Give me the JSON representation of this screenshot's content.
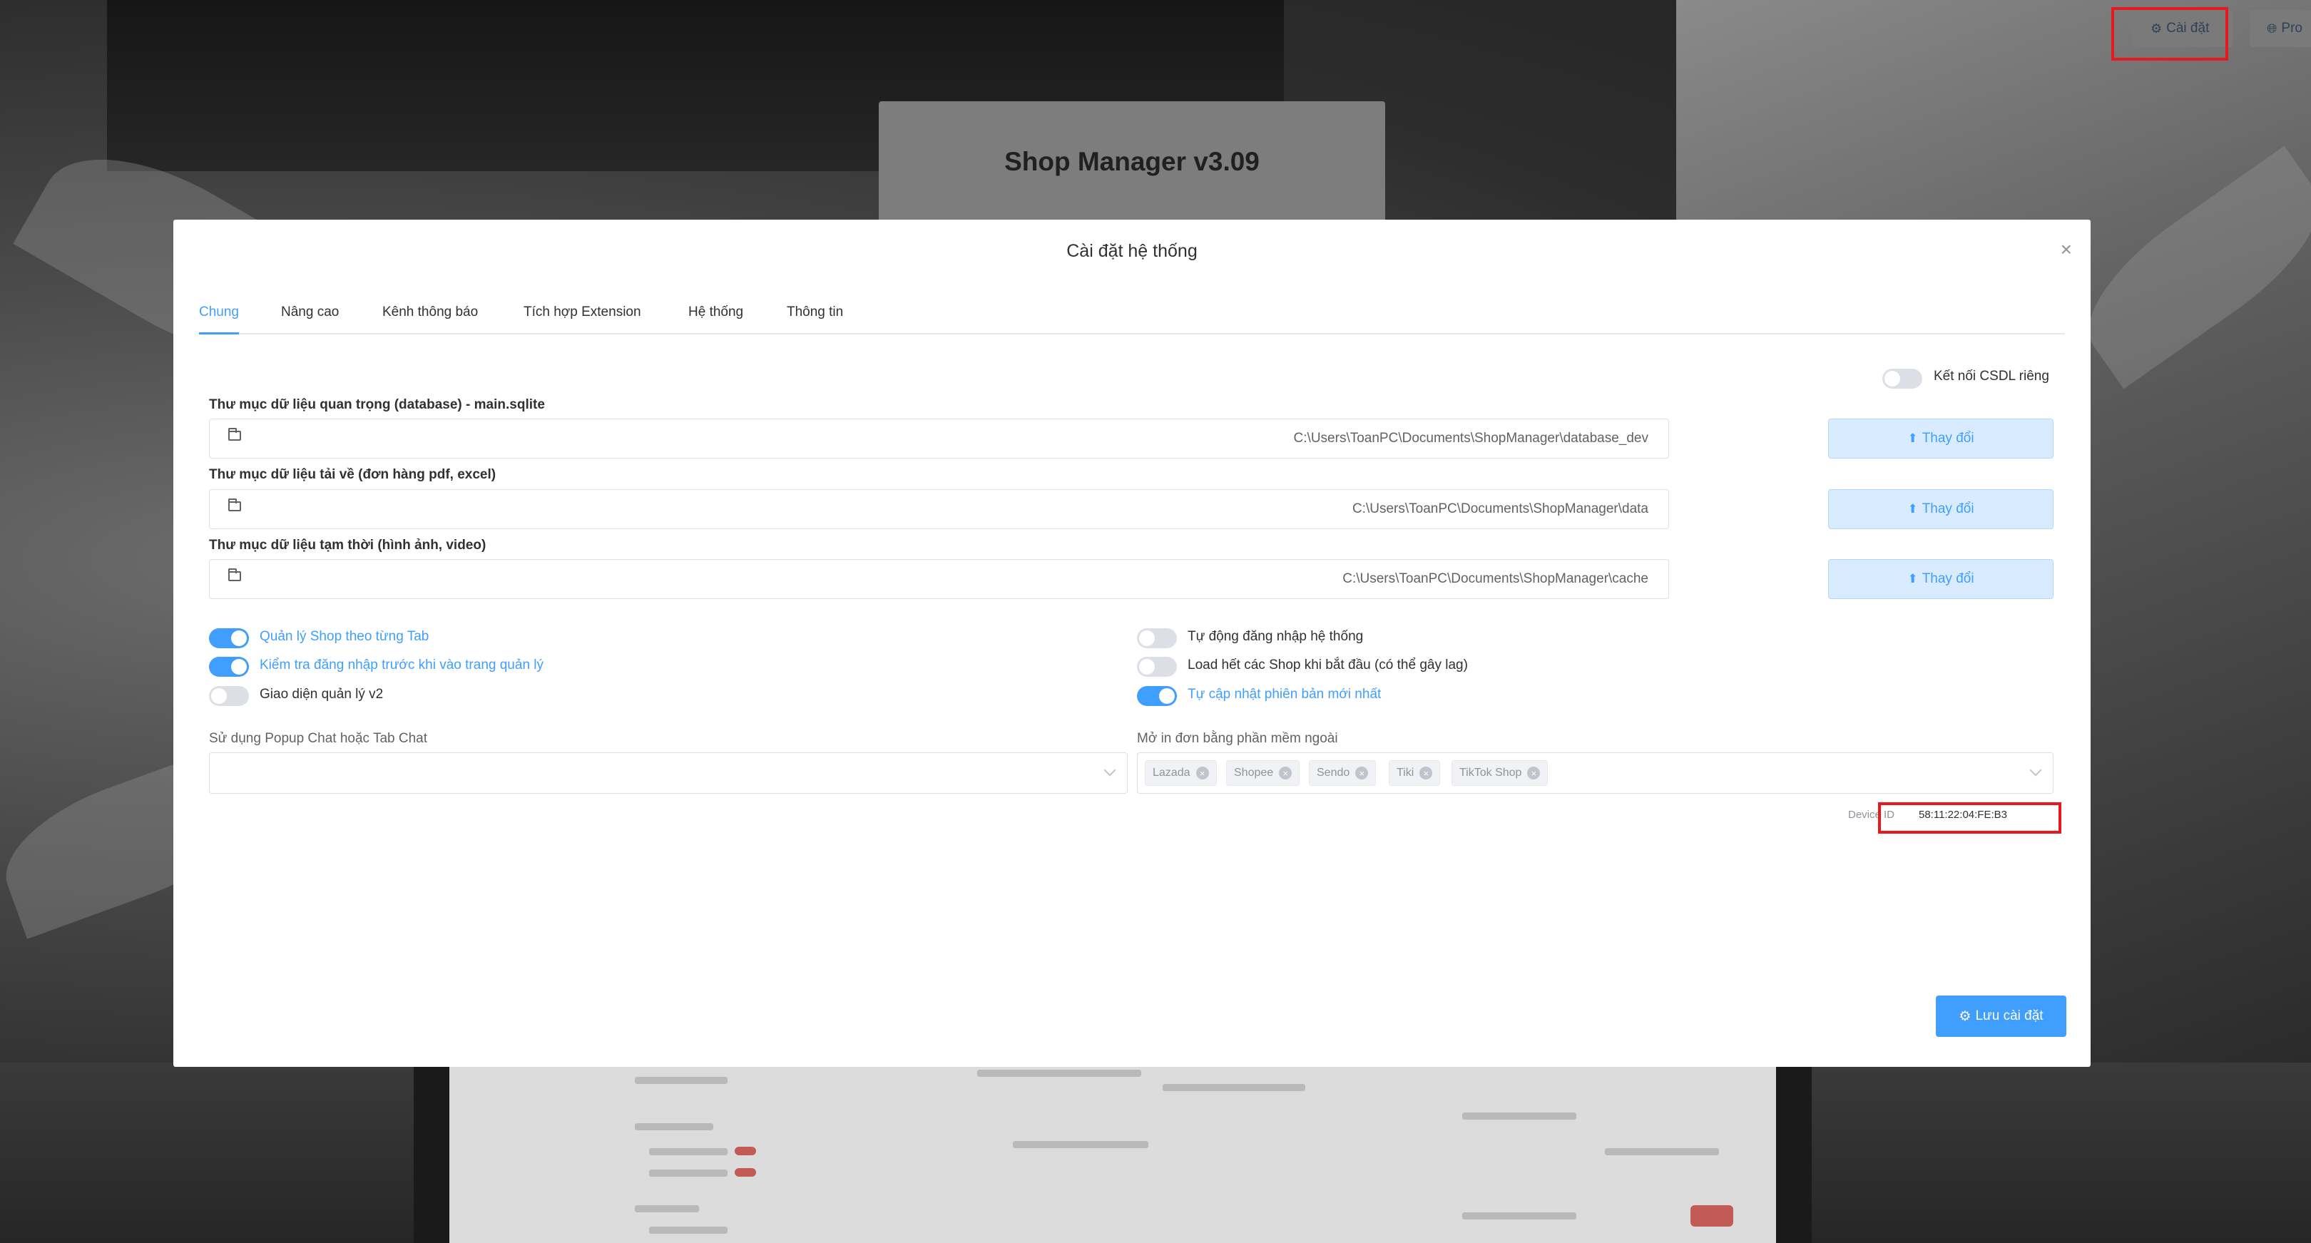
{
  "top_buttons": {
    "settings_label": "Cài đặt",
    "proxy_label": "Pro"
  },
  "background_card": {
    "title": "Shop Manager v3.09"
  },
  "modal": {
    "title": "Cài đặt hệ thống",
    "close_icon": "close-icon",
    "tabs": [
      "Chung",
      "Nâng cao",
      "Kênh thông báo",
      "Tích hợp Extension",
      "Hệ thống",
      "Thông tin"
    ],
    "active_tab": "Chung",
    "private_db": {
      "label": "Kết nối CSDL riêng",
      "on": false
    },
    "folders": [
      {
        "label": "Thư mục dữ liệu quan trọng (database) - main.sqlite",
        "value": "C:\\Users\\ToanPC\\Documents\\ShopManager\\database_dev",
        "button": "Thay đổi"
      },
      {
        "label": "Thư mục dữ liệu tải về (đơn hàng pdf, excel)",
        "value": "C:\\Users\\ToanPC\\Documents\\ShopManager\\data",
        "button": "Thay đổi"
      },
      {
        "label": "Thư mục dữ liệu tạm thời (hình ảnh, video)",
        "value": "C:\\Users\\ToanPC\\Documents\\ShopManager\\cache",
        "button": "Thay đổi"
      }
    ],
    "toggles_left": [
      {
        "label": "Quản lý Shop theo từng Tab",
        "on": true
      },
      {
        "label": "Kiểm tra đăng nhập trước khi vào trang quản lý",
        "on": true
      },
      {
        "label": "Giao diện quản lý v2",
        "on": false
      }
    ],
    "toggles_right": [
      {
        "label": "Tự động đăng nhập hệ thống",
        "on": false
      },
      {
        "label": "Load hết các Shop khi bắt đầu (có thể gây lag)",
        "on": false
      },
      {
        "label": "Tự cập nhật phiên bản mới nhất",
        "on": true
      }
    ],
    "chat_select": {
      "label": "Sử dụng Popup Chat hoặc Tab Chat",
      "value": ""
    },
    "print_select": {
      "label": "Mở in đơn bằng phần mềm ngoài",
      "chips": [
        "Lazada",
        "Shopee",
        "Sendo",
        "Tiki",
        "TikTok Shop"
      ]
    },
    "device": {
      "label": "Device ID",
      "value": "58:11:22:04:FE:B3"
    },
    "save_label": "Lưu cài đặt"
  },
  "colors": {
    "accent": "#409eff",
    "highlight": "#e5191f"
  }
}
